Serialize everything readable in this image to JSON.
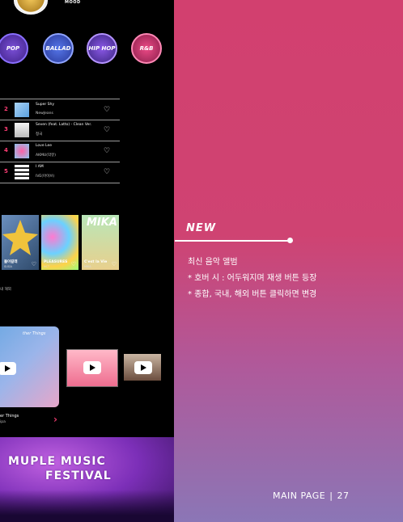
{
  "mood": {
    "label": "MOOD"
  },
  "genres": [
    "POP",
    "BALLAD",
    "HIP HOP",
    "R&B"
  ],
  "chart": [
    {
      "rank": "2",
      "title": "Super Shy",
      "artist": "NewJeans"
    },
    {
      "rank": "3",
      "title": "Seven (feat. Latto) - Clean Ver.",
      "artist": "정국"
    },
    {
      "rank": "4",
      "title": "Love Lee",
      "artist": "AKMU(악뮤)"
    },
    {
      "rank": "5",
      "title": "I AM",
      "artist": "IVE(아이브)"
    }
  ],
  "albums": [
    {
      "title": "돌아갈래",
      "artist": "SUGA"
    },
    {
      "title": "PLEASURES",
      "artist": "NCT"
    },
    {
      "title": "C'est la Vie",
      "artist": "MIKA",
      "cover_text": "MIKA"
    }
  ],
  "album_tabs": "내 해외",
  "videos": {
    "caption_title": "er Things",
    "caption_sub": "ipa",
    "big_text": "ther Things"
  },
  "festival": {
    "line1": "MUPLE MUSIC",
    "line2": "FESTIVAL"
  },
  "annotation": {
    "heading": "NEW",
    "lines": [
      "최신 음악 앨범",
      "* 호버 시 : 어두워지며 재생 버튼 등장",
      "* 종합, 국내, 해외 버튼 클릭하면 변경"
    ]
  },
  "footer": {
    "label": "MAIN PAGE",
    "separator": "|",
    "page": "27"
  },
  "colors": {
    "accent": "#ff3d75",
    "panel_top": "#d2406f",
    "panel_bottom": "#8b76b6"
  }
}
